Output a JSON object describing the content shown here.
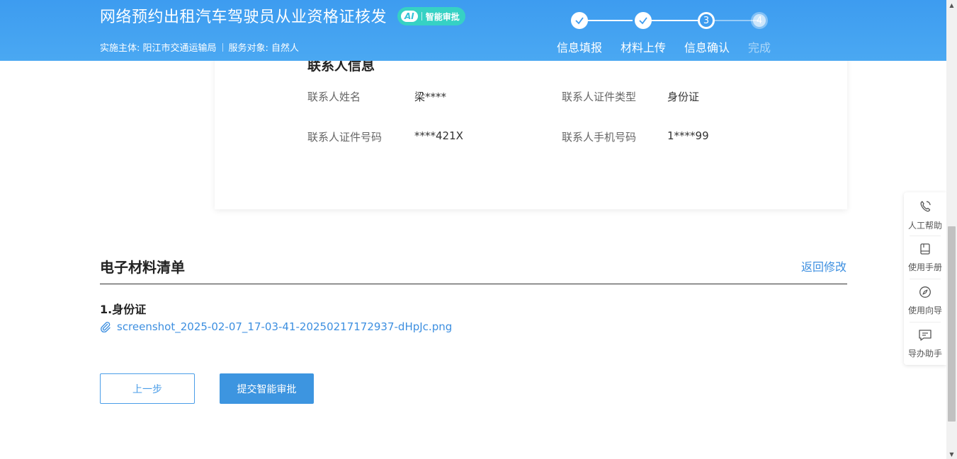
{
  "header": {
    "title": "网络预约出租汽车驾驶员从业资格证核发",
    "ai_badge": {
      "mark": "AI",
      "label": "智能审批"
    },
    "subtitle_entity": "实施主体: 阳江市交通运输局",
    "subtitle_target": "服务对象: 自然人",
    "steps": [
      {
        "number": "1",
        "label": "信息填报",
        "status": "done"
      },
      {
        "number": "2",
        "label": "材料上传",
        "status": "done"
      },
      {
        "number": "3",
        "label": "信息确认",
        "status": "current"
      },
      {
        "number": "4",
        "label": "完成",
        "status": "todo"
      }
    ]
  },
  "contact": {
    "title": "联系人信息",
    "fields": [
      {
        "label": "联系人姓名",
        "value": "梁****"
      },
      {
        "label": "联系人证件类型",
        "value": "身份证"
      },
      {
        "label": "联系人证件号码",
        "value": "****421X"
      },
      {
        "label": "联系人手机号码",
        "value": "1****99"
      }
    ]
  },
  "materials": {
    "title": "电子材料清单",
    "back_link": "返回修改",
    "items": [
      {
        "title": "1.身份证",
        "file": "screenshot_2025-02-07_17-03-41-20250217172937-dHpJc.png"
      }
    ]
  },
  "actions": {
    "prev_label": "上一步",
    "submit_label": "提交智能审批"
  },
  "float_bar": {
    "items": [
      {
        "label": "人工帮助",
        "icon": "phone-icon"
      },
      {
        "label": "使用手册",
        "icon": "book-icon"
      },
      {
        "label": "使用向导",
        "icon": "compass-icon"
      },
      {
        "label": "导办助手",
        "icon": "chat-icon"
      }
    ]
  },
  "colors": {
    "header_blue": "#3d9cf0",
    "link_blue": "#3d8fe0",
    "ai_badge": "#36d1c4"
  }
}
